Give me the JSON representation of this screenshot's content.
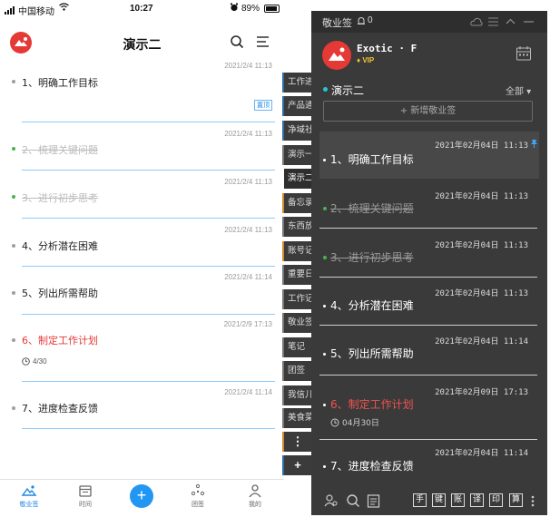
{
  "phone": {
    "status": {
      "carrier": "中国移动",
      "time": "10:27",
      "battery": "89%"
    },
    "header": {
      "title": "演示二"
    },
    "items": [
      {
        "date": "2021/2/4 11:13",
        "text": "1、明确工作目标",
        "badge": "置顶",
        "state": "normal"
      },
      {
        "date": "2021/2/4 11:13",
        "text": "2、梳理关键问题",
        "state": "done"
      },
      {
        "date": "2021/2/4 11:13",
        "text": "3、进行初步思考",
        "state": "done"
      },
      {
        "date": "2021/2/4 11:13",
        "text": "4、分析潜在困难",
        "state": "normal"
      },
      {
        "date": "2021/2/4 11:14",
        "text": "5、列出所需帮助",
        "state": "normal"
      },
      {
        "date": "2021/2/9 17:13",
        "text": "6、制定工作计划",
        "due": "4/30",
        "state": "red"
      },
      {
        "date": "2021/2/4 11:14",
        "text": "7、进度检查反馈",
        "state": "normal"
      }
    ],
    "tabs": [
      {
        "label": "敬业签"
      },
      {
        "label": "时间"
      },
      {
        "label": "团签"
      },
      {
        "label": "我的"
      }
    ],
    "add_label": "+"
  },
  "side_tabs": [
    "工作进",
    "产品通",
    "净域社",
    "演示一",
    "演示二",
    "备忘录",
    "东西放",
    "账号记",
    "重要日",
    "工作记",
    "敬业签",
    "笔记",
    "团签",
    "我信儿",
    "美食菜",
    "⋮",
    "+"
  ],
  "widget": {
    "app_title": "敬业签",
    "bell_count": "0",
    "user": {
      "name": "Exotic · F",
      "vip": "VIP"
    },
    "group": {
      "name": "演示二",
      "filter": "全部"
    },
    "add_button": "+ 新增敬业签",
    "items": [
      {
        "date": "2021年02月04日  11:13",
        "text": "1、明确工作目标",
        "state": "normal",
        "pinned": true
      },
      {
        "date": "2021年02月04日  11:13",
        "text": "2、梳理关键问题",
        "state": "done"
      },
      {
        "date": "2021年02月04日  11:13",
        "text": "3、进行初步思考",
        "state": "done"
      },
      {
        "date": "2021年02月04日  11:13",
        "text": "4、分析潜在困难",
        "state": "normal"
      },
      {
        "date": "2021年02月04日  11:14",
        "text": "5、列出所需帮助",
        "state": "normal"
      },
      {
        "date": "2021年02月09日  17:13",
        "text": "6、制定工作计划",
        "due": "04月30日",
        "state": "red"
      },
      {
        "date": "2021年02月04日  11:14",
        "text": "7、进度检查反馈",
        "state": "normal"
      }
    ],
    "bottom_keys": [
      "手",
      "键",
      "账",
      "译",
      "印",
      "算"
    ]
  },
  "colors": {
    "accent": "#2196f3",
    "widget_bg": "#3a3a3a",
    "red": "#e53935",
    "done_dot": "#4caf50"
  }
}
